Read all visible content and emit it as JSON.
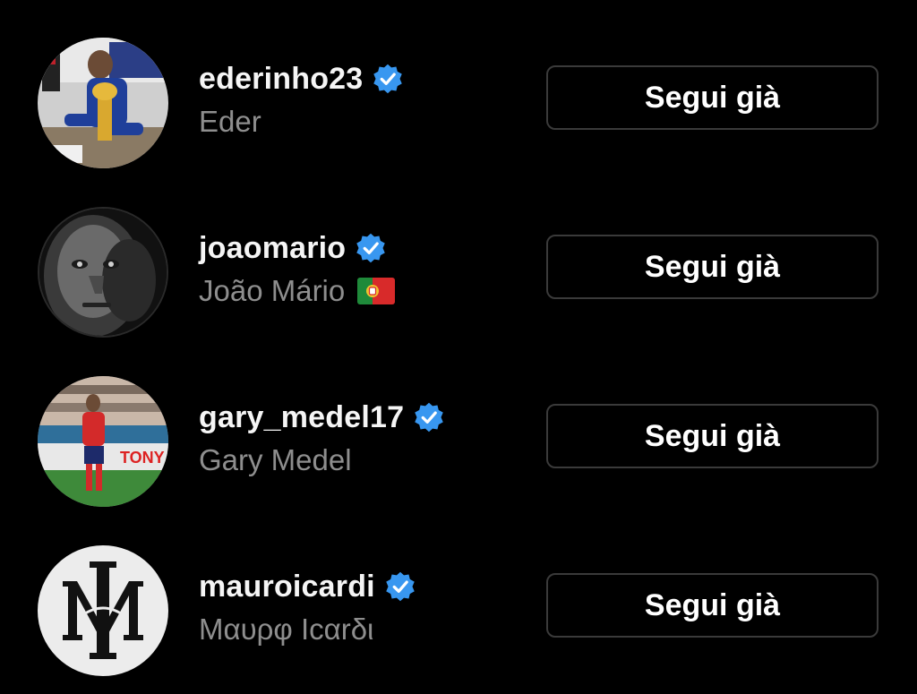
{
  "accounts": [
    {
      "username": "ederinho23",
      "full_name": "Eder",
      "verified": true,
      "follow_label": "Segui già",
      "avatar": "photo-player-with-trophy"
    },
    {
      "username": "joaomario",
      "full_name": "João Mário",
      "verified": true,
      "follow_label": "Segui già",
      "avatar": "photo-lion-face-portrait",
      "flag": "portugal-flag-icon"
    },
    {
      "username": "gary_medel17",
      "full_name": "Gary Medel",
      "verified": true,
      "follow_label": "Segui già",
      "avatar": "photo-player-red-kit-on-pitch"
    },
    {
      "username": "mauroicardi",
      "full_name": "Μαυρφ Ιcαrδι",
      "verified": true,
      "follow_label": "Segui già",
      "avatar": "logo-mi-monogram"
    }
  ],
  "colors": {
    "background": "#000000",
    "username": "#f5f5f5",
    "full_name": "#8e8e8e",
    "verified_badge": "#3897f0",
    "button_border": "#3a3a3a"
  }
}
